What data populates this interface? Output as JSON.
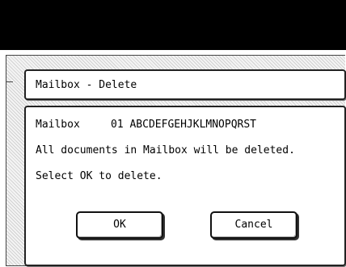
{
  "dialog": {
    "title": "Mailbox - Delete",
    "mailbox_label": "Mailbox",
    "mailbox_value": "01 ABCDEFGEHJKLMNOPQRST",
    "message_line1": "All documents in Mailbox will be deleted.",
    "message_line2": "Select OK to delete."
  },
  "buttons": {
    "ok_label": "OK",
    "cancel_label": "Cancel"
  }
}
